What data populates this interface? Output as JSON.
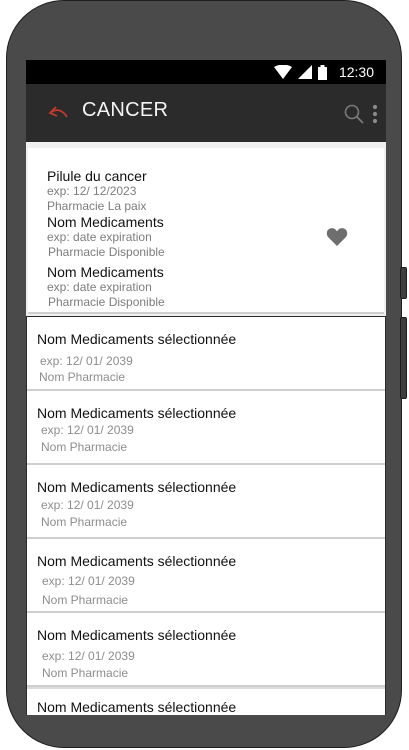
{
  "status_bar": {
    "time": "12:30",
    "icons": [
      "wifi-icon",
      "cellular-signal-icon",
      "battery-icon"
    ]
  },
  "app_bar": {
    "title": "CANCER",
    "back_icon": "back-arrow-icon",
    "actions": [
      "search-icon",
      "more-vert-icon"
    ],
    "accent_color": "#c0392b"
  },
  "favorites": {
    "items": [
      {
        "name": "Pilule du cancer",
        "exp": "exp: 12/ 12/2023",
        "pharmacy": "Pharmacie La paix"
      },
      {
        "name": "Nom Medicaments",
        "exp": "exp: date expiration",
        "pharmacy": "Pharmacie Disponible"
      },
      {
        "name": "Nom Medicaments",
        "exp": "exp: date expiration",
        "pharmacy": "Pharmacie Disponible"
      }
    ],
    "action_icon": "heart-icon"
  },
  "selected_list": [
    {
      "name": "Nom Medicaments sélectionnée",
      "exp": "exp: 12/ 01/ 2039",
      "pharmacy": "Nom Pharmacie"
    },
    {
      "name": "Nom Medicaments sélectionnée",
      "exp": "exp: 12/ 01/ 2039",
      "pharmacy": "Nom Pharmacie"
    },
    {
      "name": "Nom Medicaments sélectionnée",
      "exp": "exp: 12/ 01/ 2039",
      "pharmacy": "Nom Pharmacie"
    },
    {
      "name": "Nom Medicaments sélectionnée",
      "exp": "exp: 12/ 01/ 2039",
      "pharmacy": "Nom Pharmacie"
    },
    {
      "name": "Nom Medicaments sélectionnée",
      "exp": "exp: 12/ 01/ 2039",
      "pharmacy": "Nom Pharmacie"
    },
    {
      "name": "Nom Medicaments sélectionnée"
    }
  ]
}
